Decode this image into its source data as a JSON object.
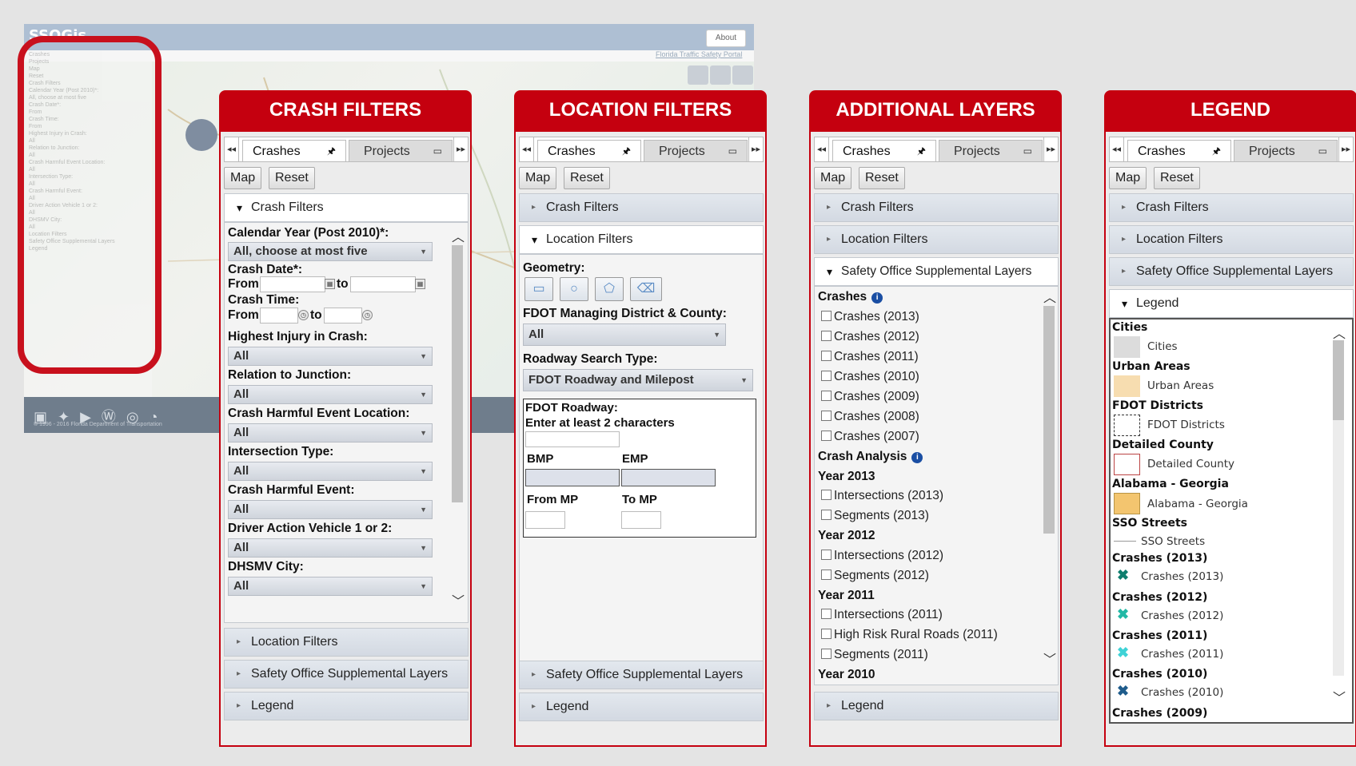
{
  "app": {
    "logo": "SSOGis",
    "about": "About",
    "portal_link": "Florida Traffic Safety Portal",
    "footer_copy": "© 1996 - 2016 Florida Department of Transportation",
    "social_icons": [
      "facebook-icon",
      "twitter-icon",
      "youtube-icon",
      "wordpress-icon",
      "flickr-icon",
      "rss-icon"
    ],
    "mini_panel": {
      "tab_a": "Crashes",
      "tab_b": "Projects",
      "btn_map": "Map",
      "btn_reset": "Reset",
      "items": [
        "Crash Filters",
        "Calendar Year (Post 2010)*:",
        "All, choose at most five",
        "Crash Date*:",
        "From",
        "Crash Time:",
        "From",
        "Highest Injury in Crash:",
        "All",
        "Relation to Junction:",
        "All",
        "Crash Harmful Event Location:",
        "All",
        "Intersection Type:",
        "All",
        "Crash Harmful Event:",
        "All",
        "Driver Action Vehicle 1 or 2:",
        "All",
        "DHSMV City:",
        "All",
        "Location Filters",
        "Safety Office Supplemental Layers",
        "Legend"
      ]
    }
  },
  "common": {
    "tab_crashes": "Crashes",
    "tab_projects": "Projects",
    "btn_map": "Map",
    "btn_reset": "Reset",
    "acc_crash": "Crash Filters",
    "acc_location": "Location Filters",
    "acc_supp": "Safety Office Supplemental Layers",
    "acc_legend": "Legend"
  },
  "colors": {
    "accent_red": "#c5000f",
    "info_blue": "#1a4ea3"
  },
  "crash_filters": {
    "title": "CRASH FILTERS",
    "calendar_label": "Calendar Year (Post 2010)*:",
    "calendar_value": "All, choose at most five",
    "date_label": "Crash Date*:",
    "from": "From",
    "to": "to",
    "time_label": "Crash Time:",
    "fields": [
      {
        "label": "Highest Injury in Crash:",
        "value": "All"
      },
      {
        "label": "Relation to Junction:",
        "value": "All"
      },
      {
        "label": "Crash Harmful Event Location:",
        "value": "All"
      },
      {
        "label": "Intersection Type:",
        "value": "All"
      },
      {
        "label": "Crash Harmful Event:",
        "value": "All"
      },
      {
        "label": "Driver Action Vehicle 1 or 2:",
        "value": "All"
      },
      {
        "label": "DHSMV City:",
        "value": "All"
      }
    ]
  },
  "location_filters": {
    "title": "LOCATION FILTERS",
    "geometry_label": "Geometry:",
    "district_label": "FDOT Managing District & County:",
    "district_value": "All",
    "search_type_label": "Roadway Search Type:",
    "search_type_value": "FDOT Roadway and Milepost",
    "roadway_label": "FDOT Roadway:",
    "roadway_hint": "Enter at least 2 characters",
    "bmp": "BMP",
    "emp": "EMP",
    "from_mp": "From MP",
    "to_mp": "To MP"
  },
  "additional_layers": {
    "title": "ADDITIONAL LAYERS",
    "crashes_heading": "Crashes",
    "crash_layers": [
      "Crashes (2013)",
      "Crashes (2012)",
      "Crashes (2011)",
      "Crashes (2010)",
      "Crashes (2009)",
      "Crashes (2008)",
      "Crashes (2007)"
    ],
    "analysis_heading": "Crash Analysis",
    "years": [
      {
        "year": "Year 2013",
        "items": [
          "Intersections (2013)",
          "Segments (2013)"
        ]
      },
      {
        "year": "Year 2012",
        "items": [
          "Intersections (2012)",
          "Segments (2012)"
        ]
      },
      {
        "year": "Year 2011",
        "items": [
          "Intersections (2011)",
          "High Risk Rural Roads (2011)",
          "Segments (2011)"
        ]
      },
      {
        "year": "Year 2010",
        "items": []
      }
    ]
  },
  "legend": {
    "title": "LEGEND",
    "groups": [
      {
        "heading": "Cities",
        "item": "Cities",
        "swatch": "#dcdcdc"
      },
      {
        "heading": "Urban Areas",
        "item": "Urban Areas",
        "swatch": "#f7ddb0"
      },
      {
        "heading": "FDOT Districts",
        "item": "FDOT Districts",
        "swatch": "dashed"
      },
      {
        "heading": "Detailed County",
        "item": "Detailed County",
        "swatch": "#ffffff"
      },
      {
        "heading": "Alabama - Georgia",
        "item": "Alabama - Georgia",
        "swatch": "#f3c56f"
      },
      {
        "heading": "SSO Streets",
        "item": "SSO Streets",
        "swatch": "line"
      },
      {
        "heading": "Crashes (2013)",
        "item": "Crashes (2013)",
        "swatch": "#0e7e6e"
      },
      {
        "heading": "Crashes (2012)",
        "item": "Crashes (2012)",
        "swatch": "#22b8a5"
      },
      {
        "heading": "Crashes (2011)",
        "item": "Crashes (2011)",
        "swatch": "#3fd2d6"
      },
      {
        "heading": "Crashes (2010)",
        "item": "Crashes (2010)",
        "swatch": "#1f5c8c"
      },
      {
        "heading": "Crashes (2009)",
        "item": "",
        "swatch": ""
      }
    ]
  }
}
